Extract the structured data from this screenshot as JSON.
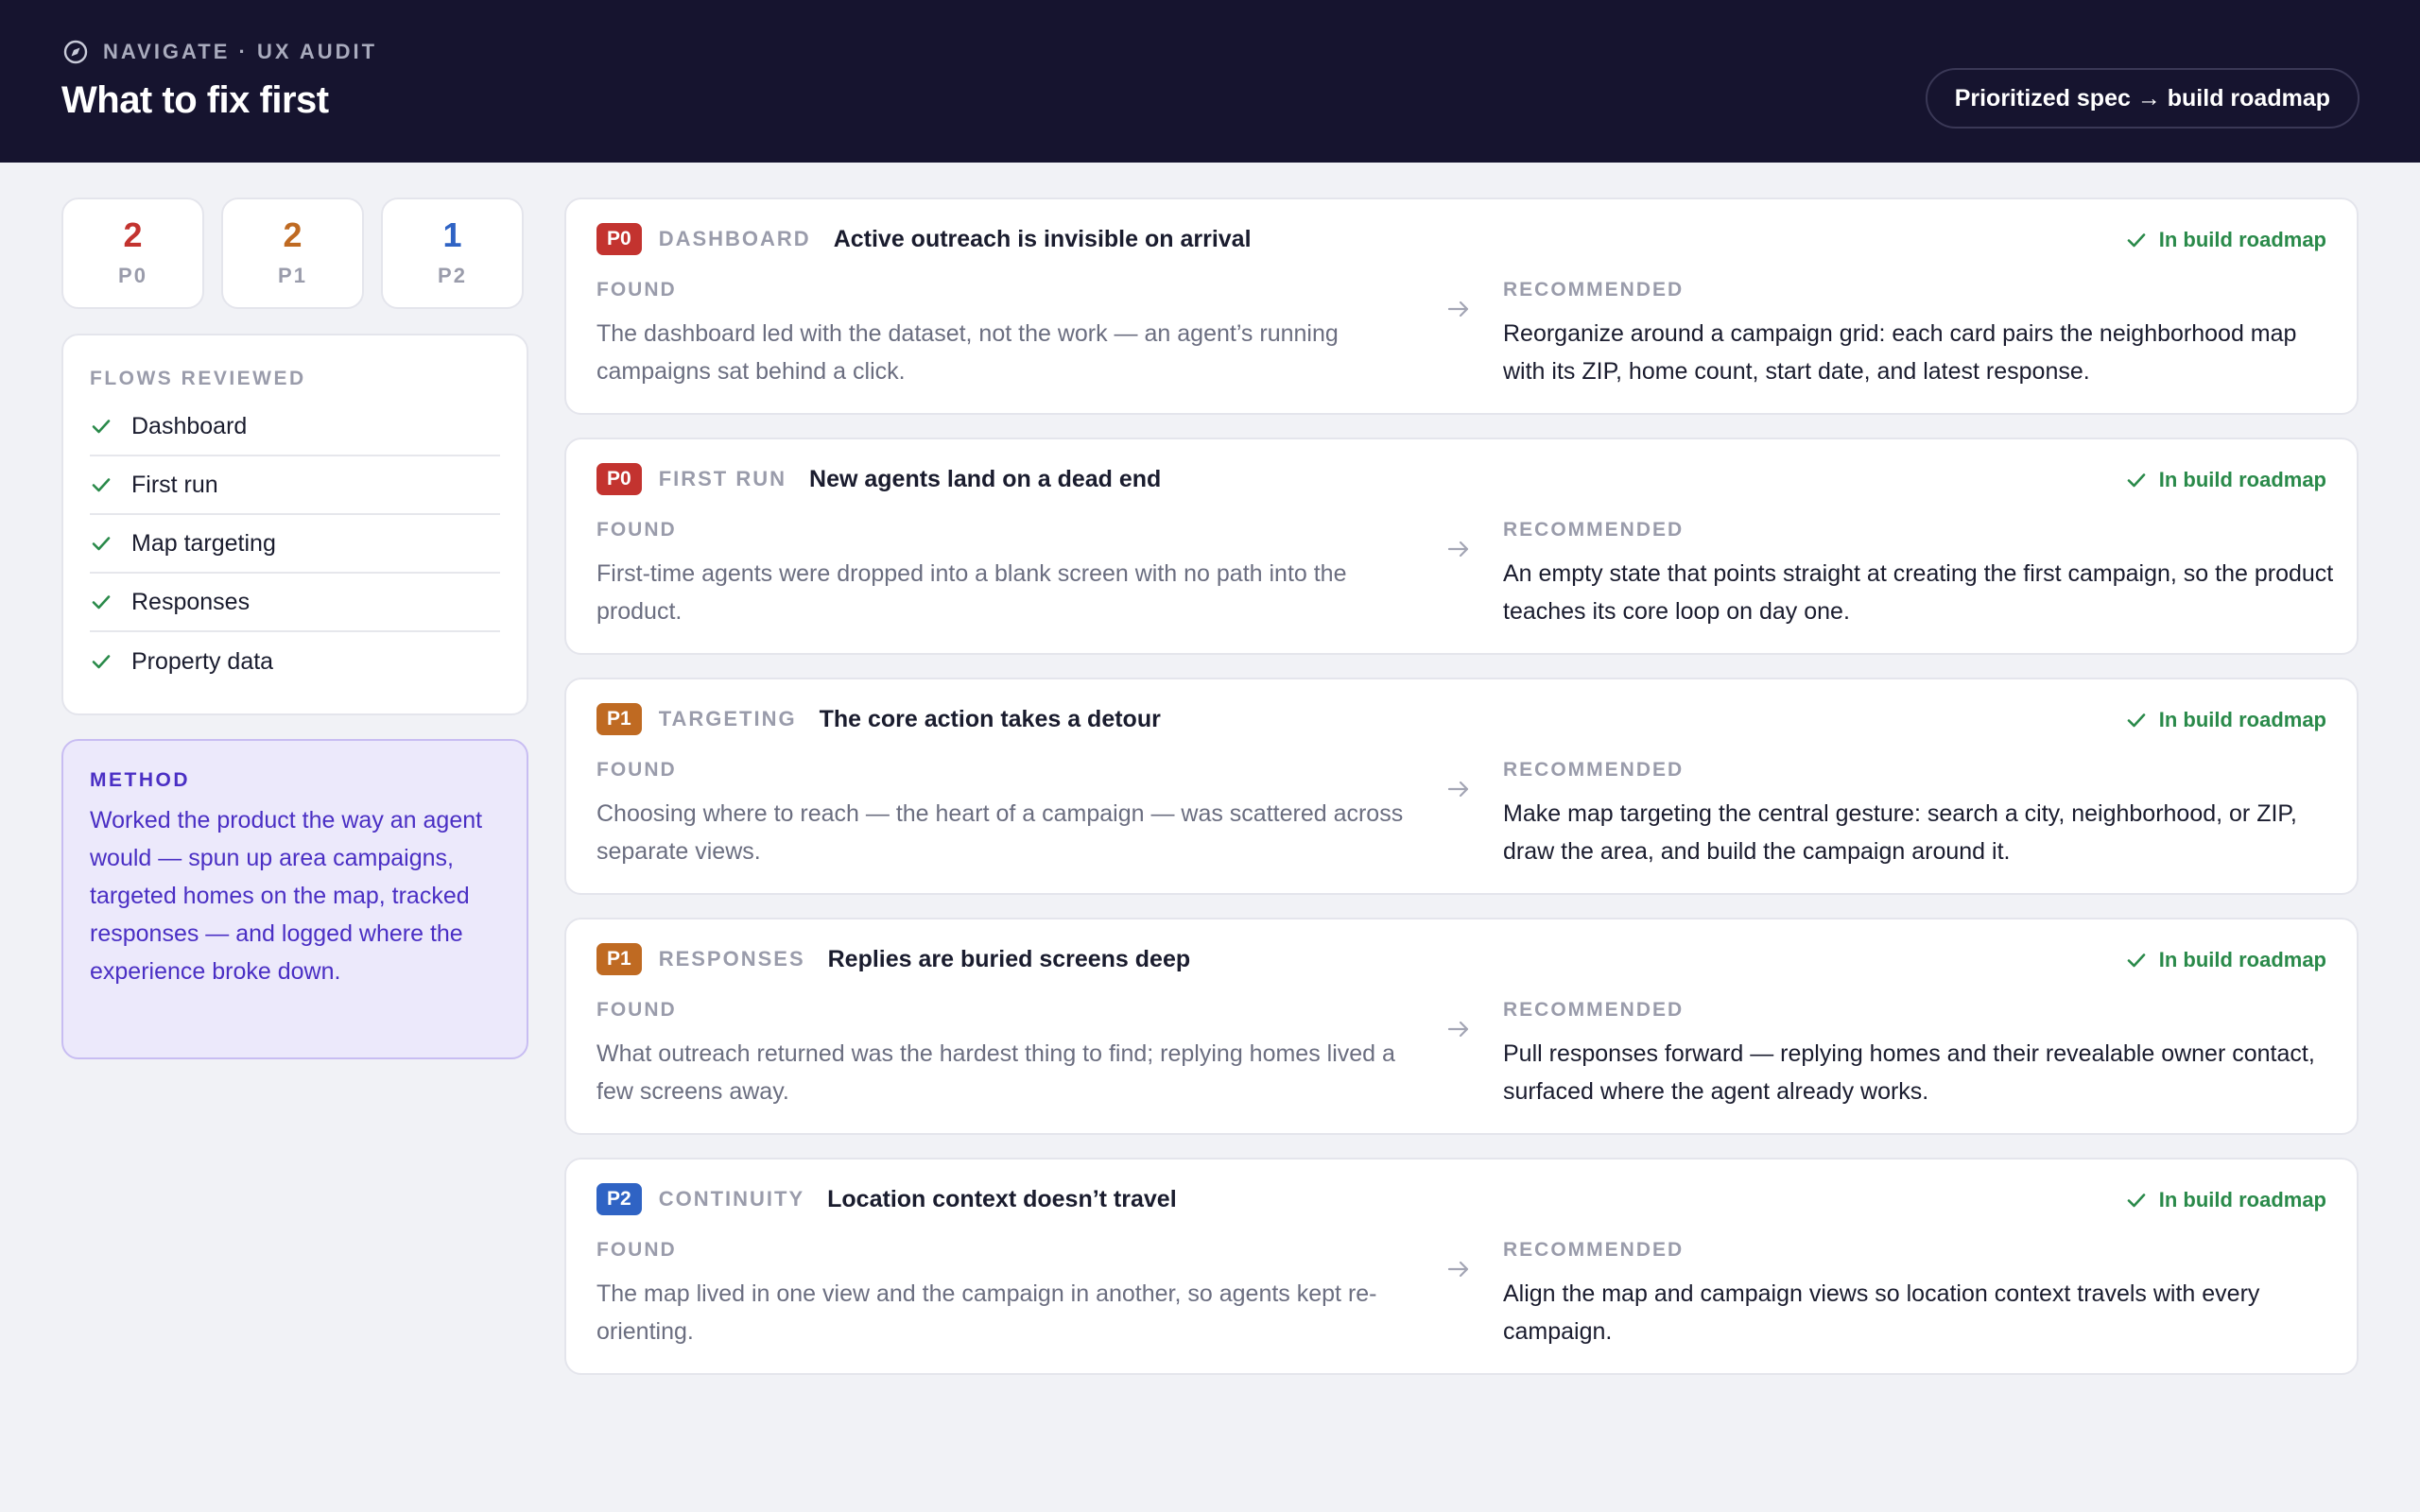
{
  "header": {
    "eyebrow": "NAVIGATE · UX AUDIT",
    "title": "What to fix first",
    "pill_label": "Prioritized spec → build roadmap"
  },
  "counts": [
    {
      "value": "2",
      "label": "P0",
      "color": "#c3332f"
    },
    {
      "value": "2",
      "label": "P1",
      "color": "#bf6a22"
    },
    {
      "value": "1",
      "label": "P2",
      "color": "#2f63c4"
    }
  ],
  "flows": {
    "heading": "FLOWS REVIEWED",
    "items": [
      "Dashboard",
      "First run",
      "Map targeting",
      "Responses",
      "Property data"
    ]
  },
  "method": {
    "heading": "METHOD",
    "body": "Worked the product the way an agent would — spun up area campaigns, targeted homes on the map, tracked responses — and logged where the experience broke down."
  },
  "labels": {
    "found": "FOUND",
    "recommended": "RECOMMENDED",
    "status": "In build roadmap"
  },
  "findings": [
    {
      "priority": "P0",
      "area": "DASHBOARD",
      "title": "Active outreach is invisible on arrival",
      "found": "The dashboard led with the dataset, not the work — an agent’s running campaigns sat behind a click.",
      "recommended": "Reorganize around a campaign grid: each card pairs the neighborhood map with its ZIP, home count, start date, and latest response."
    },
    {
      "priority": "P0",
      "area": "FIRST RUN",
      "title": "New agents land on a dead end",
      "found": "First-time agents were dropped into a blank screen with no path into the product.",
      "recommended": "An empty state that points straight at creating the first campaign, so the product teaches its core loop on day one."
    },
    {
      "priority": "P1",
      "area": "TARGETING",
      "title": "The core action takes a detour",
      "found": "Choosing where to reach — the heart of a campaign — was scattered across separate views.",
      "recommended": "Make map targeting the central gesture: search a city, neighborhood, or ZIP, draw the area, and build the campaign around it."
    },
    {
      "priority": "P1",
      "area": "RESPONSES",
      "title": "Replies are buried screens deep",
      "found": "What outreach returned was the hardest thing to find; replying homes lived a few screens away.",
      "recommended": "Pull responses forward — replying homes and their revealable owner contact, surfaced where the agent already works."
    },
    {
      "priority": "P2",
      "area": "CONTINUITY",
      "title": "Location context doesn’t travel",
      "found": "The map lived in one view and the campaign in another, so agents kept re-orienting.",
      "recommended": "Align the map and campaign views so location context travels with every campaign."
    }
  ]
}
